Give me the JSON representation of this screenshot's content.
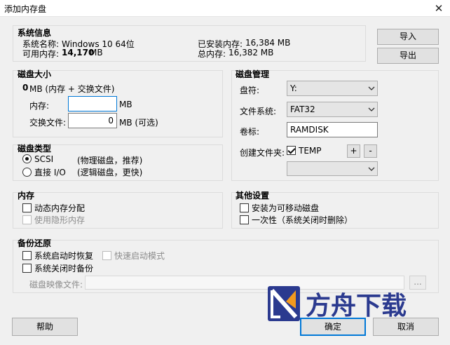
{
  "window": {
    "title": "添加内存盘",
    "close_glyph": "✕"
  },
  "system_info": {
    "title": "系统信息",
    "os_label": "系统名称:",
    "os_value": "Windows 10 64位",
    "avail_label": "可用内存:",
    "avail_value": "14,170",
    "avail_unit": "MB",
    "installed_label": "已安装内存:",
    "installed_value": "16,384 MB",
    "total_label": "总内存:",
    "total_value": "16,382 MB"
  },
  "side_buttons": {
    "import": "导入",
    "export": "导出"
  },
  "disk_size": {
    "title": "磁盘大小",
    "total_value": "0",
    "total_suffix": "MB (内存 + 交换文件)",
    "memory_label": "内存:",
    "memory_value": "",
    "memory_unit": "MB",
    "swap_label": "交换文件:",
    "swap_value": "0",
    "swap_unit": "MB (可选)"
  },
  "disk_type": {
    "title": "磁盘类型",
    "scsi_label": "SCSI",
    "scsi_desc": "(物理磁盘，推荐)",
    "direct_label": "直接 I/O",
    "direct_desc": "(逻辑磁盘，更快)"
  },
  "memory": {
    "title": "内存",
    "dynamic_label": "动态内存分配",
    "hidden_label": "使用隐形内存"
  },
  "disk_mgmt": {
    "title": "磁盘管理",
    "drive_label": "盘符:",
    "drive_value": "Y:",
    "fs_label": "文件系统:",
    "fs_value": "FAT32",
    "volume_label": "卷标:",
    "volume_value": "RAMDISK",
    "create_folder_label": "创建文件夹:",
    "folder_name": "TEMP",
    "plus": "+",
    "minus": "-",
    "folder_select_value": ""
  },
  "other": {
    "title": "其他设置",
    "removable_label": "安装为可移动磁盘",
    "once_label": "一次性（系统关闭时删除）"
  },
  "backup": {
    "title": "备份还原",
    "restore_label": "系统启动时恢复",
    "quick_label": "快速启动模式",
    "backup_label": "系统关闭时备份",
    "image_label": "磁盘映像文件:",
    "image_value": "",
    "browse": "..."
  },
  "footer": {
    "help": "帮助",
    "ok": "确定",
    "cancel": "取消"
  },
  "watermark": {
    "text": "方舟下载"
  },
  "colors": {
    "accent": "#0078d7",
    "wm_blue": "#2b3a8f",
    "wm_orange": "#f39a1e"
  }
}
